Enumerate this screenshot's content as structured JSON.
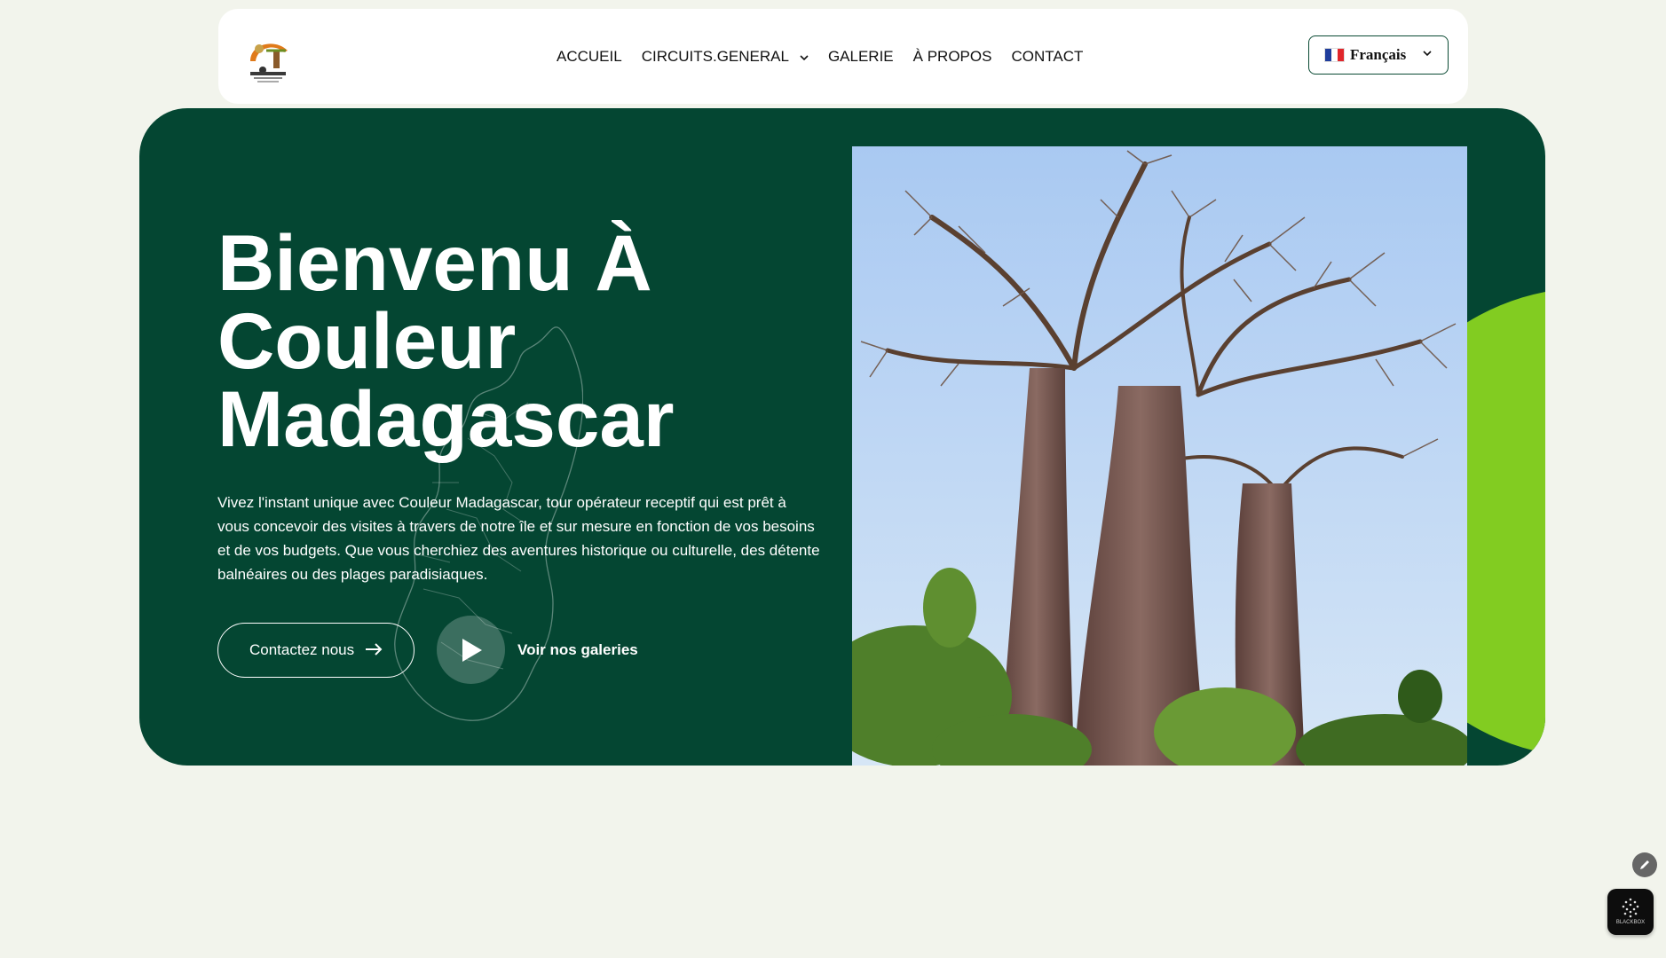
{
  "header": {
    "logo_alt": "Couleur Madagascar",
    "nav": [
      {
        "label": "ACCUEIL",
        "has_dropdown": false
      },
      {
        "label": "CIRCUITS.GENERAL",
        "has_dropdown": true
      },
      {
        "label": "GALERIE",
        "has_dropdown": false
      },
      {
        "label": "À PROPOS",
        "has_dropdown": false
      },
      {
        "label": "CONTACT",
        "has_dropdown": false
      }
    ],
    "language": {
      "label": "Français",
      "flag": "french-flag-icon"
    }
  },
  "hero": {
    "title": "Bienvenu À Couleur Madagascar",
    "description": "Vivez l'instant unique avec Couleur Madagascar, tour opérateur receptif qui est prêt à vous concevoir des visites à travers de notre île et sur mesure en fonction de vos besoins et de vos budgets. Que vous cherchiez des aventures historique ou culturelle, des détente balnéaires ou des plages paradisiaques.",
    "contact_button": "Contactez nous",
    "gallery_link": "Voir nos galeries",
    "image": "baobab-trees-photo"
  },
  "widgets": {
    "blackbox_label": "BLACKBOX"
  },
  "colors": {
    "page_bg": "#f2f4ec",
    "hero_bg": "#044632",
    "accent_green": "#82cc21",
    "white": "#ffffff"
  }
}
